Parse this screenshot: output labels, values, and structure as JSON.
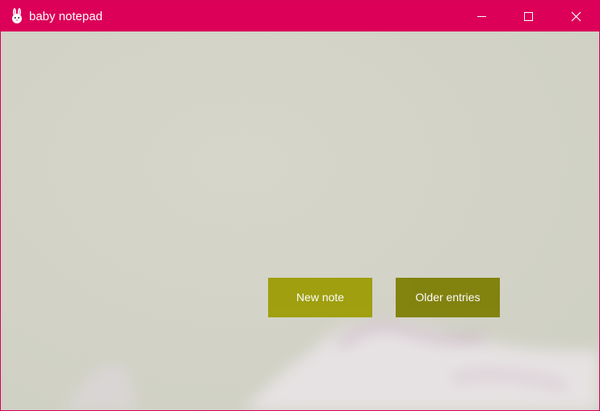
{
  "window": {
    "title": "baby notepad",
    "app_icon": "bunny-icon",
    "accent_color": "#dc0058",
    "controls": {
      "minimize_icon": "minimize-icon",
      "maximize_icon": "maximize-icon",
      "close_icon": "close-icon"
    }
  },
  "main": {
    "new_note_label": "New note",
    "older_entries_label": "Older entries",
    "new_note_color": "#9b9b00",
    "older_entries_color": "#7c7c00"
  }
}
